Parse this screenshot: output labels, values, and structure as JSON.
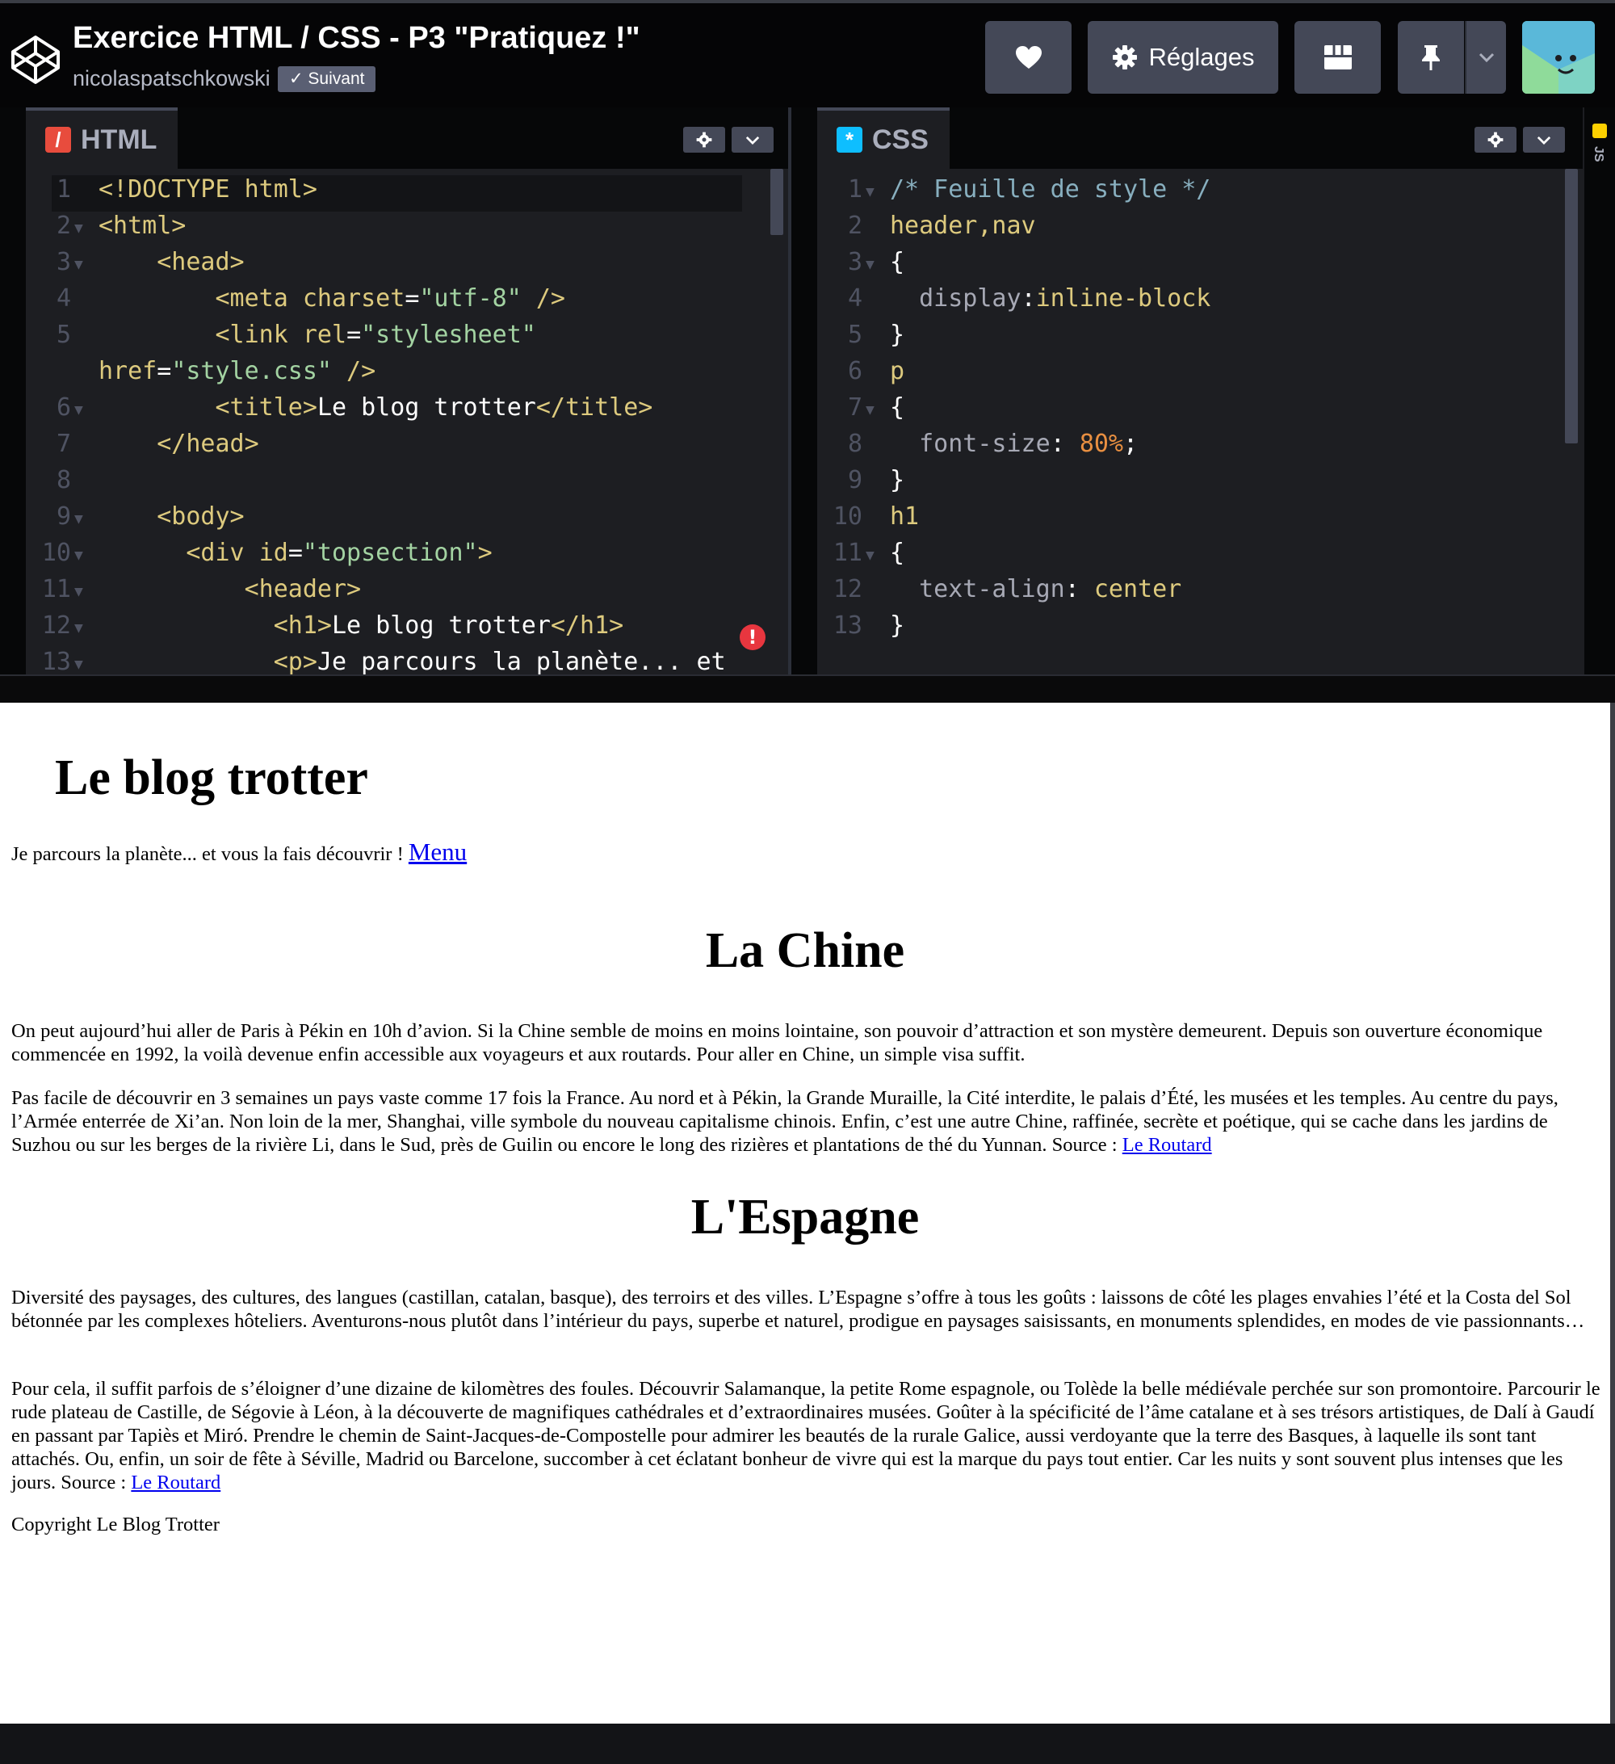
{
  "topbar": {
    "title": "Exercice HTML / CSS - P3 \"Pratiquez !\"",
    "author": "nicolaspatschkowski",
    "follow_badge": "✓ Suivant",
    "settings_label": "Réglages"
  },
  "html_editor": {
    "tab_label": "HTML",
    "tab_icon_glyph": "/",
    "lines": [
      {
        "n": "1",
        "fold": false,
        "code": [
          [
            "t-tag",
            "<!DOCTYPE html>"
          ]
        ]
      },
      {
        "n": "2",
        "fold": true,
        "code": [
          [
            "t-tag",
            "<html>"
          ]
        ]
      },
      {
        "n": "3",
        "fold": true,
        "code": [
          [
            "t-plain",
            "    "
          ],
          [
            "t-tag",
            "<head>"
          ]
        ]
      },
      {
        "n": "4",
        "fold": false,
        "code": [
          [
            "t-plain",
            "        "
          ],
          [
            "t-tag",
            "<meta "
          ],
          [
            "t-attr",
            "charset"
          ],
          [
            "t-plain",
            "="
          ],
          [
            "t-val",
            "\"utf-8\""
          ],
          [
            "t-tag",
            " />"
          ]
        ]
      },
      {
        "n": "5",
        "fold": false,
        "code": [
          [
            "t-plain",
            "        "
          ],
          [
            "t-tag",
            "<link "
          ],
          [
            "t-attr",
            "rel"
          ],
          [
            "t-plain",
            "="
          ],
          [
            "t-val",
            "\"stylesheet\""
          ]
        ]
      },
      {
        "n": "",
        "fold": false,
        "code": [
          [
            "t-attr",
            "href"
          ],
          [
            "t-plain",
            "="
          ],
          [
            "t-val",
            "\"style.css\""
          ],
          [
            "t-tag",
            " />"
          ]
        ]
      },
      {
        "n": "6",
        "fold": true,
        "code": [
          [
            "t-plain",
            "        "
          ],
          [
            "t-tag",
            "<title>"
          ],
          [
            "t-plain",
            "Le blog trotter"
          ],
          [
            "t-tag",
            "</title>"
          ]
        ]
      },
      {
        "n": "7",
        "fold": false,
        "code": [
          [
            "t-plain",
            "    "
          ],
          [
            "t-tag",
            "</head>"
          ]
        ]
      },
      {
        "n": "8",
        "fold": false,
        "code": []
      },
      {
        "n": "9",
        "fold": true,
        "code": [
          [
            "t-plain",
            "    "
          ],
          [
            "t-tag",
            "<body>"
          ]
        ]
      },
      {
        "n": "10",
        "fold": true,
        "code": [
          [
            "t-plain",
            "      "
          ],
          [
            "t-tag",
            "<div "
          ],
          [
            "t-attr",
            "id"
          ],
          [
            "t-plain",
            "="
          ],
          [
            "t-val",
            "\"topsection\""
          ],
          [
            "t-tag",
            ">"
          ]
        ]
      },
      {
        "n": "11",
        "fold": true,
        "code": [
          [
            "t-plain",
            "          "
          ],
          [
            "t-tag",
            "<header>"
          ]
        ]
      },
      {
        "n": "12",
        "fold": true,
        "code": [
          [
            "t-plain",
            "            "
          ],
          [
            "t-tag",
            "<h1>"
          ],
          [
            "t-plain",
            "Le blog trotter"
          ],
          [
            "t-tag",
            "</h1>"
          ]
        ]
      },
      {
        "n": "13",
        "fold": true,
        "code": [
          [
            "t-plain",
            "            "
          ],
          [
            "t-tag",
            "<p>"
          ],
          [
            "t-plain",
            "Je parcours la planète... et"
          ]
        ]
      }
    ]
  },
  "css_editor": {
    "tab_label": "CSS",
    "tab_icon_glyph": "*",
    "lines": [
      {
        "n": "1",
        "fold": true,
        "code": [
          [
            "t-com",
            "/* Feuille de style */"
          ]
        ]
      },
      {
        "n": "2",
        "fold": false,
        "code": [
          [
            "t-sel",
            "header,nav"
          ]
        ]
      },
      {
        "n": "3",
        "fold": true,
        "code": [
          [
            "t-plain",
            "{"
          ]
        ]
      },
      {
        "n": "4",
        "fold": false,
        "code": [
          [
            "t-plain",
            "  "
          ],
          [
            "t-prop",
            "display"
          ],
          [
            "t-plain",
            ":"
          ],
          [
            "t-sel",
            "inline-block"
          ]
        ]
      },
      {
        "n": "5",
        "fold": false,
        "code": [
          [
            "t-plain",
            "}"
          ]
        ]
      },
      {
        "n": "6",
        "fold": false,
        "code": [
          [
            "t-sel",
            "p"
          ]
        ]
      },
      {
        "n": "7",
        "fold": true,
        "code": [
          [
            "t-plain",
            "{"
          ]
        ]
      },
      {
        "n": "8",
        "fold": false,
        "code": [
          [
            "t-plain",
            "  "
          ],
          [
            "t-prop",
            "font-size"
          ],
          [
            "t-plain",
            ": "
          ],
          [
            "t-num",
            "80%"
          ],
          [
            "t-plain",
            ";"
          ]
        ]
      },
      {
        "n": "9",
        "fold": false,
        "code": [
          [
            "t-plain",
            "}"
          ]
        ]
      },
      {
        "n": "10",
        "fold": false,
        "code": [
          [
            "t-sel",
            "h1"
          ]
        ]
      },
      {
        "n": "11",
        "fold": true,
        "code": [
          [
            "t-plain",
            "{"
          ]
        ]
      },
      {
        "n": "12",
        "fold": false,
        "code": [
          [
            "t-plain",
            "  "
          ],
          [
            "t-prop",
            "text-align"
          ],
          [
            "t-plain",
            ": "
          ],
          [
            "t-sel",
            "center"
          ]
        ]
      },
      {
        "n": "13",
        "fold": false,
        "code": [
          [
            "t-plain",
            "}"
          ]
        ]
      }
    ]
  },
  "js_strip": {
    "label": "JS"
  },
  "preview": {
    "site_title": "Le blog trotter",
    "tagline": "Je parcours la planète... et vous la fais découvrir ! ",
    "menu_link": "Menu",
    "china": {
      "heading": "La Chine",
      "p1": "On peut aujourd’hui aller de Paris à Pékin en 10h d’avion. Si la Chine semble de moins en moins lointaine, son pouvoir d’attraction et son mystère demeurent. Depuis son ouverture économique commencée en 1992, la voilà devenue enfin accessible aux voyageurs et aux routards. Pour aller en Chine, un simple visa suffit.",
      "p2": "Pas facile de découvrir en 3 semaines un pays vaste comme 17 fois la France. Au nord et à Pékin, la Grande Muraille, la Cité interdite, le palais d’Été, les musées et les temples. Au centre du pays, l’Armée enterrée de Xi’an. Non loin de la mer, Shanghai, ville symbole du nouveau capitalisme chinois. Enfin, c’est une autre Chine, raffinée, secrète et poétique, qui se cache dans les jardins de Suzhou ou sur les berges de la rivière Li, dans le Sud, près de Guilin ou encore le long des rizières et plantations de thé du Yunnan. Source : ",
      "source_link": "Le Routard"
    },
    "spain": {
      "heading": "L'Espagne",
      "p1": "Diversité des paysages, des cultures, des langues (castillan, catalan, basque), des terroirs et des villes. L’Espagne s’offre à tous les goûts : laissons de côté les plages envahies l’été et la Costa del Sol bétonnée par les complexes hôteliers. Aventurons-nous plutôt dans l’intérieur du pays, superbe et naturel, prodigue en paysages saisissants, en monuments splendides, en modes de vie passionnants…",
      "p2": "Pour cela, il suffit parfois de s’éloigner d’une dizaine de kilomètres des foules. Découvrir Salamanque, la petite Rome espagnole, ou Tolède la belle médiévale perchée sur son promontoire. Parcourir le rude plateau de Castille, de Ségovie à Léon, à la découverte de magnifiques cathédrales et d’extraordinaires musées. Goûter à la spécificité de l’âme catalane et à ses trésors artistiques, de Dalí à Gaudí en passant par Tapiès et Miró. Prendre le chemin de Saint-Jacques-de-Compostelle pour admirer les beautés de la rurale Galice, aussi verdoyante que la terre des Basques, à laquelle ils sont tant attachés. Ou, enfin, un soir de fête à Séville, Madrid ou Barcelone, succomber à cet éclatant bonheur de vivre qui est la marque du pays tout entier. Car les nuits y sont souvent plus intenses que les jours. Source : ",
      "source_link": "Le Routard"
    },
    "copyright": "Copyright Le Blog Trotter"
  },
  "colors": {
    "topbar_bg": "#050506",
    "editor_bg": "#1d1e22",
    "button_bg": "#444857",
    "link": "#0000ee",
    "error": "#e8363f"
  }
}
